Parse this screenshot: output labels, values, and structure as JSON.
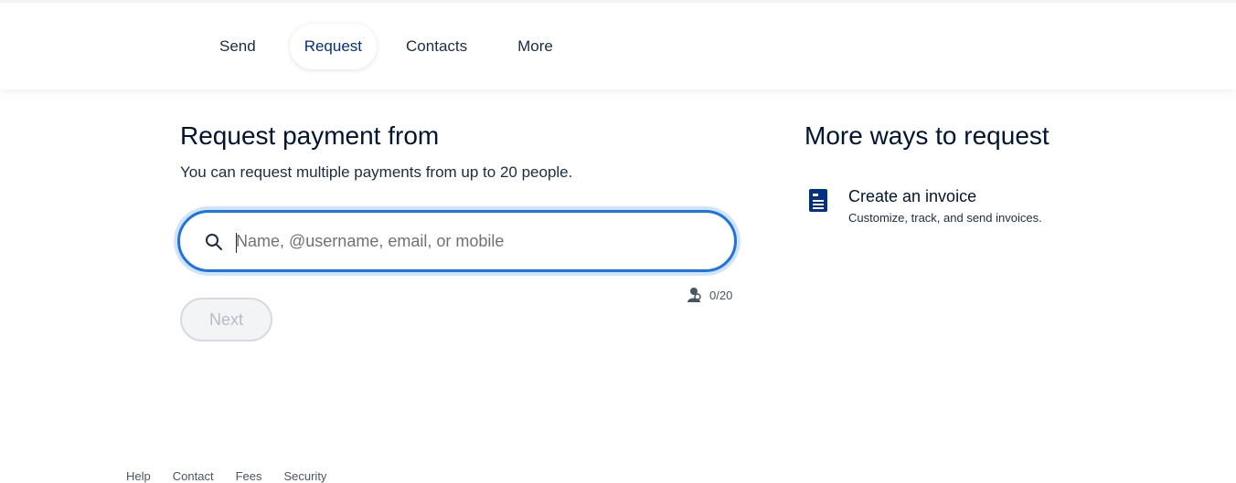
{
  "nav": {
    "items": [
      {
        "label": "Send"
      },
      {
        "label": "Request"
      },
      {
        "label": "Contacts"
      },
      {
        "label": "More"
      }
    ],
    "active": "Request"
  },
  "main": {
    "title": "Request payment from",
    "subtitle": "You can request multiple payments from up to 20 people.",
    "search": {
      "placeholder": "Name, @username, email, or mobile",
      "value": "",
      "icon": "search-icon"
    },
    "counter": {
      "text": "0/20",
      "icon": "person-icon"
    },
    "next_label": "Next"
  },
  "side": {
    "title": "More ways to request",
    "invoice": {
      "title": "Create an invoice",
      "description": "Customize, track, and send invoices.",
      "icon": "invoice-icon"
    }
  },
  "footer": {
    "links": [
      "Help",
      "Contact",
      "Fees",
      "Security"
    ]
  },
  "colors": {
    "accent": "#1a73e8",
    "brand_navy": "#003087",
    "text": "#001435"
  }
}
